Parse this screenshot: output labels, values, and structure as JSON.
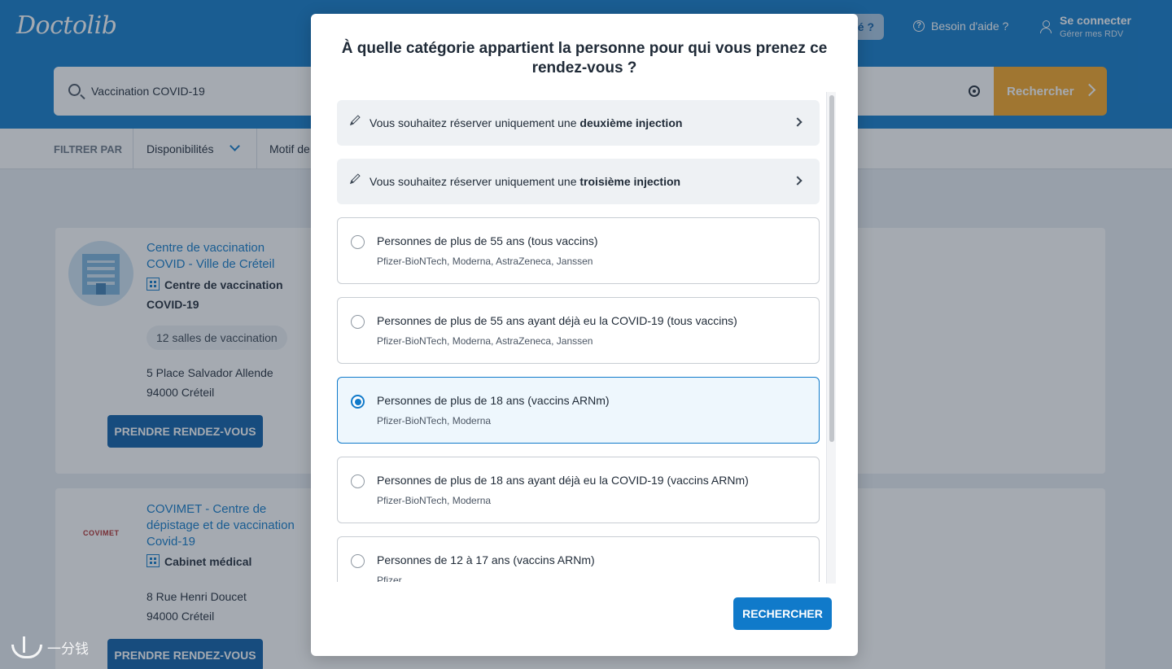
{
  "header": {
    "logo": "Doctolib",
    "pill_text": "é ?",
    "help": "Besoin d'aide ?",
    "login_title": "Se connecter",
    "login_sub": "Gérer mes RDV"
  },
  "search": {
    "value": "Vaccination COVID-19",
    "button": "Rechercher"
  },
  "filters": {
    "label": "FILTRER PAR",
    "availability": "Disponibilités",
    "motif": "Motif de"
  },
  "results": [
    {
      "name": "Centre de vaccination COVID - Ville de Créteil",
      "type": "Centre de vaccination COVID-19",
      "tag": "12 salles de vaccination",
      "address_line1": "5 Place Salvador Allende",
      "address_line2": "94000 Créteil",
      "button": "PRENDRE RENDEZ-VOUS"
    },
    {
      "name": "COVIMET - Centre de dépistage et de vaccination Covid-19",
      "logo": "COVIMET",
      "type": "Cabinet médical",
      "address_line1": "8 Rue Henri Doucet",
      "address_line2": "94000 Créteil",
      "button": "PRENDRE RENDEZ-VOUS"
    }
  ],
  "modal": {
    "title": "À quelle catégorie appartient la personne pour qui vous prenez ce rendez-vous ?",
    "shortcuts": [
      {
        "prefix": "Vous souhaitez réserver uniquement une ",
        "bold": "deuxième injection"
      },
      {
        "prefix": "Vous souhaitez réserver uniquement une ",
        "bold": "troisième injection"
      }
    ],
    "options": [
      {
        "label": "Personnes de plus de 55 ans (tous vaccins)",
        "sub": "Pfizer-BioNTech, Moderna, AstraZeneca, Janssen",
        "selected": false
      },
      {
        "label": "Personnes de plus de 55 ans ayant déjà eu la COVID-19 (tous vaccins)",
        "sub": "Pfizer-BioNTech, Moderna, AstraZeneca, Janssen",
        "selected": false
      },
      {
        "label": "Personnes de plus de 18 ans (vaccins ARNm)",
        "sub": "Pfizer-BioNTech, Moderna",
        "selected": true
      },
      {
        "label": "Personnes de plus de 18 ans ayant déjà eu la COVID-19 (vaccins ARNm)",
        "sub": "Pfizer-BioNTech, Moderna",
        "selected": false
      },
      {
        "label": "Personnes de 12 à 17 ans (vaccins ARNm)",
        "sub": "Pfizer",
        "selected": false
      }
    ],
    "button": "RECHERCHER"
  },
  "watermark": "一分钱",
  "colors": {
    "brand": "#107aca",
    "accent": "#f6a623",
    "selected_bg": "#eef7fd"
  }
}
